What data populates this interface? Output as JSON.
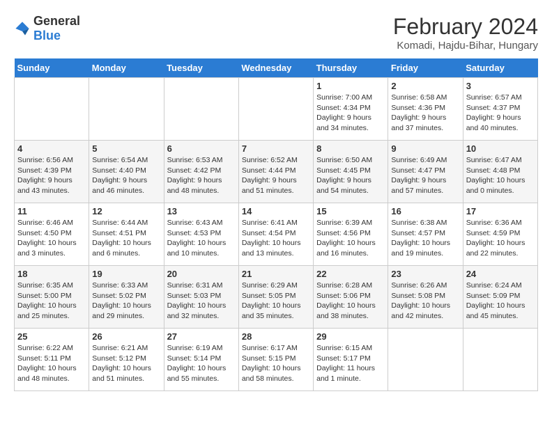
{
  "header": {
    "logo_general": "General",
    "logo_blue": "Blue",
    "month_year": "February 2024",
    "location": "Komadi, Hajdu-Bihar, Hungary"
  },
  "days_of_week": [
    "Sunday",
    "Monday",
    "Tuesday",
    "Wednesday",
    "Thursday",
    "Friday",
    "Saturday"
  ],
  "weeks": [
    [
      {
        "day": "",
        "info": ""
      },
      {
        "day": "",
        "info": ""
      },
      {
        "day": "",
        "info": ""
      },
      {
        "day": "",
        "info": ""
      },
      {
        "day": "1",
        "info": "Sunrise: 7:00 AM\nSunset: 4:34 PM\nDaylight: 9 hours\nand 34 minutes."
      },
      {
        "day": "2",
        "info": "Sunrise: 6:58 AM\nSunset: 4:36 PM\nDaylight: 9 hours\nand 37 minutes."
      },
      {
        "day": "3",
        "info": "Sunrise: 6:57 AM\nSunset: 4:37 PM\nDaylight: 9 hours\nand 40 minutes."
      }
    ],
    [
      {
        "day": "4",
        "info": "Sunrise: 6:56 AM\nSunset: 4:39 PM\nDaylight: 9 hours\nand 43 minutes."
      },
      {
        "day": "5",
        "info": "Sunrise: 6:54 AM\nSunset: 4:40 PM\nDaylight: 9 hours\nand 46 minutes."
      },
      {
        "day": "6",
        "info": "Sunrise: 6:53 AM\nSunset: 4:42 PM\nDaylight: 9 hours\nand 48 minutes."
      },
      {
        "day": "7",
        "info": "Sunrise: 6:52 AM\nSunset: 4:44 PM\nDaylight: 9 hours\nand 51 minutes."
      },
      {
        "day": "8",
        "info": "Sunrise: 6:50 AM\nSunset: 4:45 PM\nDaylight: 9 hours\nand 54 minutes."
      },
      {
        "day": "9",
        "info": "Sunrise: 6:49 AM\nSunset: 4:47 PM\nDaylight: 9 hours\nand 57 minutes."
      },
      {
        "day": "10",
        "info": "Sunrise: 6:47 AM\nSunset: 4:48 PM\nDaylight: 10 hours\nand 0 minutes."
      }
    ],
    [
      {
        "day": "11",
        "info": "Sunrise: 6:46 AM\nSunset: 4:50 PM\nDaylight: 10 hours\nand 3 minutes."
      },
      {
        "day": "12",
        "info": "Sunrise: 6:44 AM\nSunset: 4:51 PM\nDaylight: 10 hours\nand 6 minutes."
      },
      {
        "day": "13",
        "info": "Sunrise: 6:43 AM\nSunset: 4:53 PM\nDaylight: 10 hours\nand 10 minutes."
      },
      {
        "day": "14",
        "info": "Sunrise: 6:41 AM\nSunset: 4:54 PM\nDaylight: 10 hours\nand 13 minutes."
      },
      {
        "day": "15",
        "info": "Sunrise: 6:39 AM\nSunset: 4:56 PM\nDaylight: 10 hours\nand 16 minutes."
      },
      {
        "day": "16",
        "info": "Sunrise: 6:38 AM\nSunset: 4:57 PM\nDaylight: 10 hours\nand 19 minutes."
      },
      {
        "day": "17",
        "info": "Sunrise: 6:36 AM\nSunset: 4:59 PM\nDaylight: 10 hours\nand 22 minutes."
      }
    ],
    [
      {
        "day": "18",
        "info": "Sunrise: 6:35 AM\nSunset: 5:00 PM\nDaylight: 10 hours\nand 25 minutes."
      },
      {
        "day": "19",
        "info": "Sunrise: 6:33 AM\nSunset: 5:02 PM\nDaylight: 10 hours\nand 29 minutes."
      },
      {
        "day": "20",
        "info": "Sunrise: 6:31 AM\nSunset: 5:03 PM\nDaylight: 10 hours\nand 32 minutes."
      },
      {
        "day": "21",
        "info": "Sunrise: 6:29 AM\nSunset: 5:05 PM\nDaylight: 10 hours\nand 35 minutes."
      },
      {
        "day": "22",
        "info": "Sunrise: 6:28 AM\nSunset: 5:06 PM\nDaylight: 10 hours\nand 38 minutes."
      },
      {
        "day": "23",
        "info": "Sunrise: 6:26 AM\nSunset: 5:08 PM\nDaylight: 10 hours\nand 42 minutes."
      },
      {
        "day": "24",
        "info": "Sunrise: 6:24 AM\nSunset: 5:09 PM\nDaylight: 10 hours\nand 45 minutes."
      }
    ],
    [
      {
        "day": "25",
        "info": "Sunrise: 6:22 AM\nSunset: 5:11 PM\nDaylight: 10 hours\nand 48 minutes."
      },
      {
        "day": "26",
        "info": "Sunrise: 6:21 AM\nSunset: 5:12 PM\nDaylight: 10 hours\nand 51 minutes."
      },
      {
        "day": "27",
        "info": "Sunrise: 6:19 AM\nSunset: 5:14 PM\nDaylight: 10 hours\nand 55 minutes."
      },
      {
        "day": "28",
        "info": "Sunrise: 6:17 AM\nSunset: 5:15 PM\nDaylight: 10 hours\nand 58 minutes."
      },
      {
        "day": "29",
        "info": "Sunrise: 6:15 AM\nSunset: 5:17 PM\nDaylight: 11 hours\nand 1 minute."
      },
      {
        "day": "",
        "info": ""
      },
      {
        "day": "",
        "info": ""
      }
    ]
  ]
}
